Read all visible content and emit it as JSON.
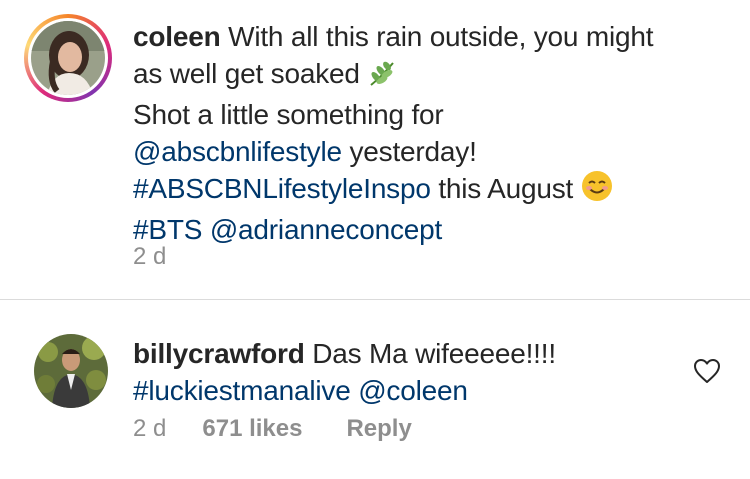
{
  "post_caption": {
    "username": "coleen",
    "line1_text": " With all this rain outside, you might",
    "line2_text": "as well get soaked ",
    "line2_emoji": "herb-emoji",
    "line3_text": "Shot a little something for",
    "mention1": "@abscbnlifestyle",
    "line4_suffix": " yesterday!",
    "hashtag1": "#ABSCBNLifestyleInspo",
    "line5_suffix": " this August ",
    "line5_emoji": "smiling-face-emoji",
    "hashtag2": "#BTS",
    "mention2": "@adrianneconcept",
    "time": "2 d"
  },
  "comment": {
    "username": "billycrawford",
    "text": " Das Ma wifeeeee!!!!",
    "hashtag": "#luckiestmanalive",
    "mention": "@coleen",
    "time": "2 d",
    "likes": "671 likes",
    "reply_label": "Reply",
    "like_icon": "heart-outline-icon"
  },
  "colors": {
    "text": "#262626",
    "link": "#00376b",
    "meta": "#8e8e8e",
    "divider": "#dbdbdb"
  }
}
